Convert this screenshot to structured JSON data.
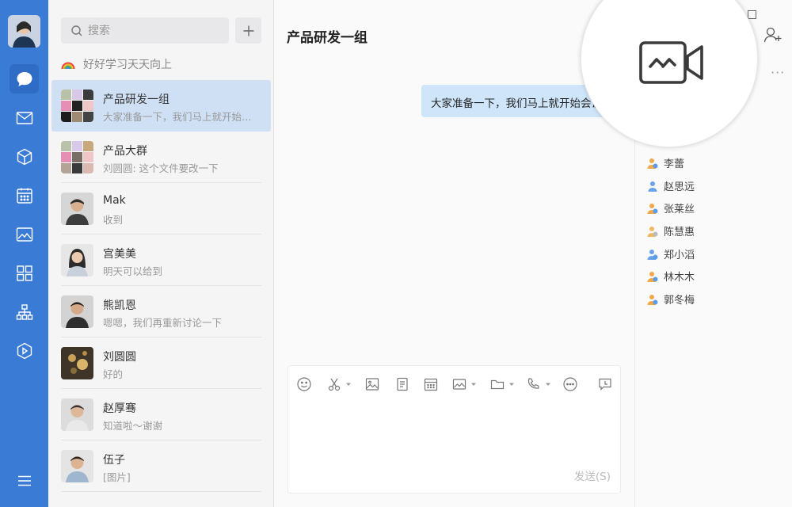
{
  "nav": {
    "items": [
      "chat-icon",
      "mail-icon",
      "cube-icon",
      "calendar-icon",
      "photo-icon",
      "apps-icon",
      "org-chart-icon",
      "hexagon-play-icon"
    ],
    "menu": "menu-icon"
  },
  "search": {
    "placeholder": "搜索"
  },
  "motto": "好好学习天天向上",
  "conversations": [
    {
      "name": "产品研发一组",
      "preview": "大家准备一下，我们马上就开始会议",
      "active": true
    },
    {
      "name": "产品大群",
      "preview": "刘圆圆: 这个文件要改一下"
    },
    {
      "name": "Mak",
      "preview": "收到"
    },
    {
      "name": "宫美美",
      "preview": "明天可以给到"
    },
    {
      "name": "熊凯恩",
      "preview": "嗯嗯，我们再重新讨论一下"
    },
    {
      "name": "刘圆圆",
      "preview": "好的"
    },
    {
      "name": "赵厚骞",
      "preview": "知道啦～谢谢"
    },
    {
      "name": "伍子",
      "preview": "[图片]"
    }
  ],
  "chat": {
    "title": "产品研发一组",
    "message": "大家准备一下，我们马上就开始会议",
    "send_label": "发送(S)"
  },
  "members": [
    "李蕾",
    "赵思远",
    "张莱丝",
    "陈慧惠",
    "郑小滔",
    "林木木",
    "郭冬梅"
  ],
  "colors": {
    "rail": "#3a7bd5",
    "active": "#cfe0f5",
    "bubble": "#cfe5fa"
  }
}
